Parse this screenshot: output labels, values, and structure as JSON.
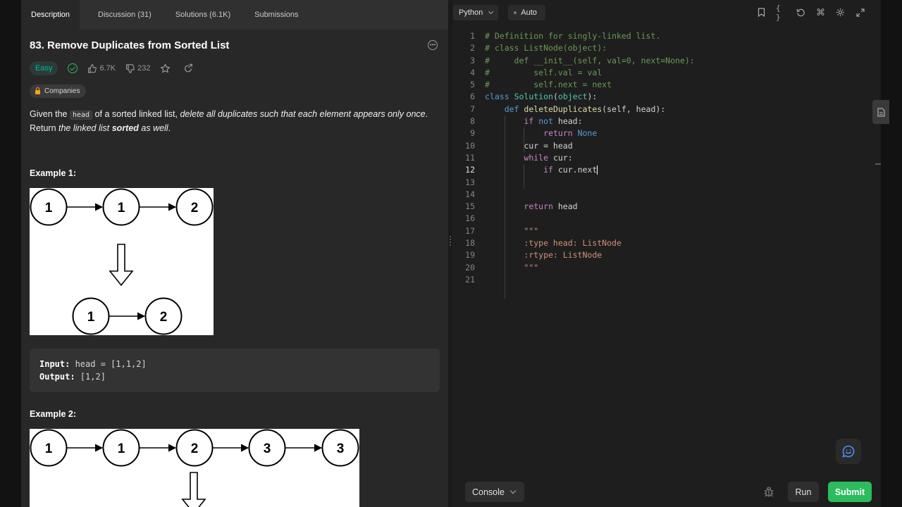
{
  "tabs": [
    {
      "label": "Description"
    },
    {
      "label": "Discussion (31)"
    },
    {
      "label": "Solutions (6.1K)"
    },
    {
      "label": "Submissions"
    }
  ],
  "problem": {
    "title": "83. Remove Duplicates from Sorted List",
    "difficulty": "Easy",
    "likes": "6.7K",
    "dislikes": "232",
    "companies_label": "Companies",
    "desc_prefix": "Given the ",
    "desc_code": "head",
    "desc_mid": " of a sorted linked list, ",
    "desc_italic1": "delete all duplicates such that each element appears only once",
    "desc_after": ". Return ",
    "desc_italic2": "the linked list ",
    "desc_bold_italic": "sorted",
    "desc_italic3": " as well",
    "desc_end": "."
  },
  "examples": [
    {
      "heading": "Example 1:",
      "input_label": "Input:",
      "input_value": " head = [1,1,2]",
      "output_label": "Output:",
      "output_value": " [1,2]",
      "top_nodes": [
        "1",
        "1",
        "2"
      ],
      "bottom_nodes": [
        "1",
        "2"
      ]
    },
    {
      "heading": "Example 2:",
      "top_nodes": [
        "1",
        "1",
        "2",
        "3",
        "3"
      ]
    }
  ],
  "editor": {
    "language": "Python",
    "mode": "Auto",
    "current_line": 12,
    "line_numbers": [
      "1",
      "2",
      "3",
      "4",
      "5",
      "6",
      "7",
      "8",
      "9",
      "10",
      "11",
      "12",
      "13",
      "14",
      "15",
      "16",
      "17",
      "18",
      "19",
      "20",
      "21"
    ]
  },
  "bottom": {
    "console_label": "Console",
    "run_label": "Run",
    "submit_label": "Submit"
  },
  "colors": {
    "accent_green": "#2cbb5d",
    "easy_teal": "#00b8a3",
    "lock_orange": "#ffa116",
    "feedback_blue": "#4f8ff7"
  }
}
